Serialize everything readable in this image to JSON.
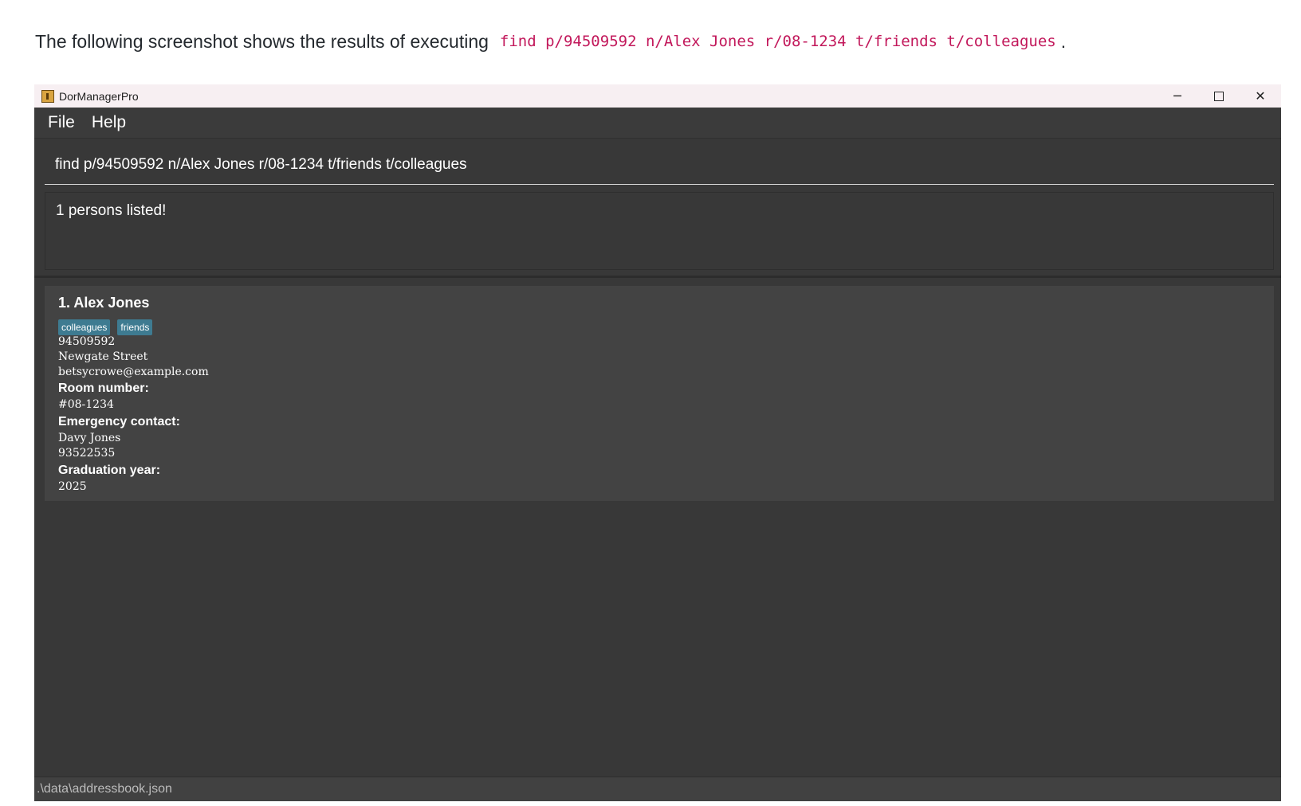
{
  "doc": {
    "intro": "The following screenshot shows the results of executing",
    "command": "find p/94509592 n/Alex Jones r/08-1234 t/friends t/colleagues",
    "period": "."
  },
  "window": {
    "title": "DorManagerPro",
    "controls": {
      "minimize": "─",
      "close": "✕"
    }
  },
  "menu": {
    "file": "File",
    "help": "Help"
  },
  "command_box": {
    "value": "find p/94509592 n/Alex Jones r/08-1234 t/friends t/colleagues"
  },
  "result_display": {
    "text": "1 persons listed!"
  },
  "person": {
    "name": "1. Alex Jones",
    "tags": [
      "colleagues",
      "friends"
    ],
    "phone": "94509592",
    "address": "Newgate Street",
    "email": "betsycrowe@example.com",
    "room_label": "Room number:",
    "room": "#08-1234",
    "emergency_label": "Emergency contact:",
    "emergency_name": "Davy Jones",
    "emergency_phone": "93522535",
    "grad_label": "Graduation year:",
    "grad_year": "2025"
  },
  "status_bar": {
    "path": ".\\data\\addressbook.json"
  },
  "colors": {
    "tag_bg": "#3e7b91",
    "window_bg": "#383838",
    "card_bg": "#434343",
    "code": "#c2185b"
  }
}
